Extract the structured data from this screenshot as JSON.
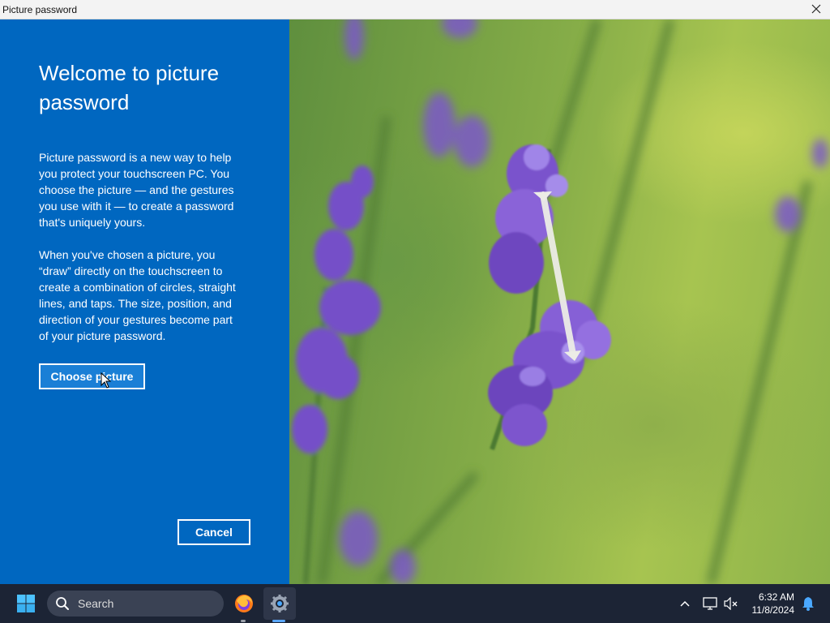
{
  "window": {
    "title": "Picture password"
  },
  "panel": {
    "heading": "Welcome to picture password",
    "paragraph1": "Picture password is a new way to help you protect your touchscreen PC. You choose the picture — and the gestures you use with it — to create a password that's uniquely yours.",
    "paragraph2": "When you've chosen a picture, you “draw” directly on the touchscreen to create a combination of circles, straight lines, and taps. The size, position, and direction of your gestures become part of your picture password.",
    "choose_label": "Choose picture",
    "cancel_label": "Cancel"
  },
  "taskbar": {
    "search_placeholder": "Search",
    "time": "6:32 AM",
    "date": "11/8/2024",
    "icons": [
      "windows-start-icon",
      "search-icon",
      "firefox-icon",
      "settings-icon",
      "chevron-up-icon",
      "network-icon",
      "volume-muted-icon",
      "notification-bell-icon"
    ]
  },
  "colors": {
    "panel_blue": "#0067c0",
    "taskbar": "#1c2435",
    "flower_purple": "#7a4fc9"
  }
}
